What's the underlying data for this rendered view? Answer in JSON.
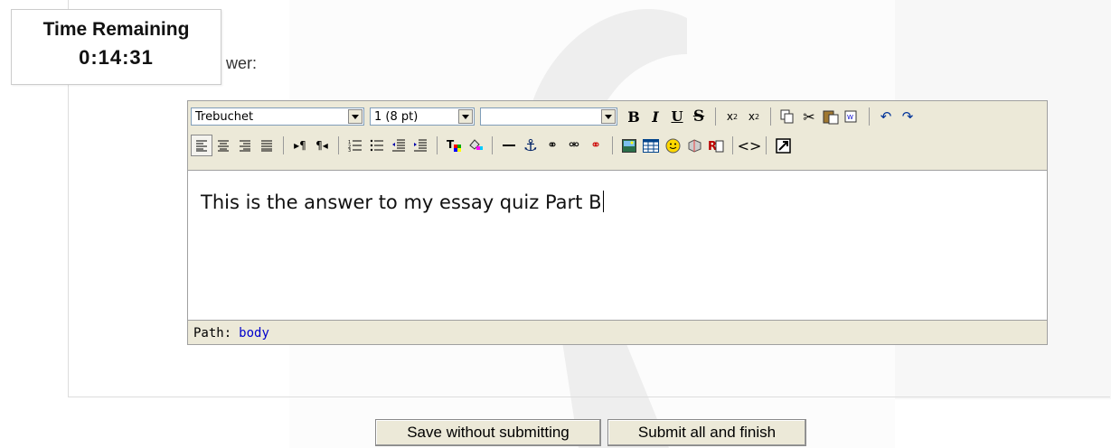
{
  "timer": {
    "title": "Time Remaining",
    "value": "0:14:31"
  },
  "question": {
    "answer_label_partial": "wer:"
  },
  "editor": {
    "font_family_value": "Trebuchet",
    "font_size_value": "1 (8 pt)",
    "format_value": "",
    "content_text": "This is the answer to my essay quiz Part B",
    "path_label": "Path:",
    "path_value": "body"
  },
  "toolbar_row1_icons": [
    "bold-icon",
    "italic-icon",
    "underline-icon",
    "strikethrough-icon",
    "subscript-icon",
    "superscript-icon",
    "copy-icon",
    "cut-icon",
    "paste-icon",
    "paste-word-icon",
    "undo-icon",
    "redo-icon"
  ],
  "toolbar_row2_icons": [
    "align-left-icon",
    "align-center-icon",
    "align-right-icon",
    "justify-icon",
    "ltr-icon",
    "rtl-icon",
    "ordered-list-icon",
    "unordered-list-icon",
    "outdent-icon",
    "indent-icon",
    "text-color-icon",
    "background-color-icon",
    "horizontal-rule-icon",
    "anchor-icon",
    "link-icon",
    "unlink-icon",
    "nolink-icon",
    "image-icon",
    "table-icon",
    "smiley-icon",
    "special-char-icon",
    "search-replace-icon",
    "html-source-icon",
    "fullscreen-icon"
  ],
  "buttons": {
    "save": "Save without submitting",
    "submit": "Submit all and finish"
  },
  "colors": {
    "editor_bg": "#ece9d8",
    "link": "#0000cc"
  }
}
